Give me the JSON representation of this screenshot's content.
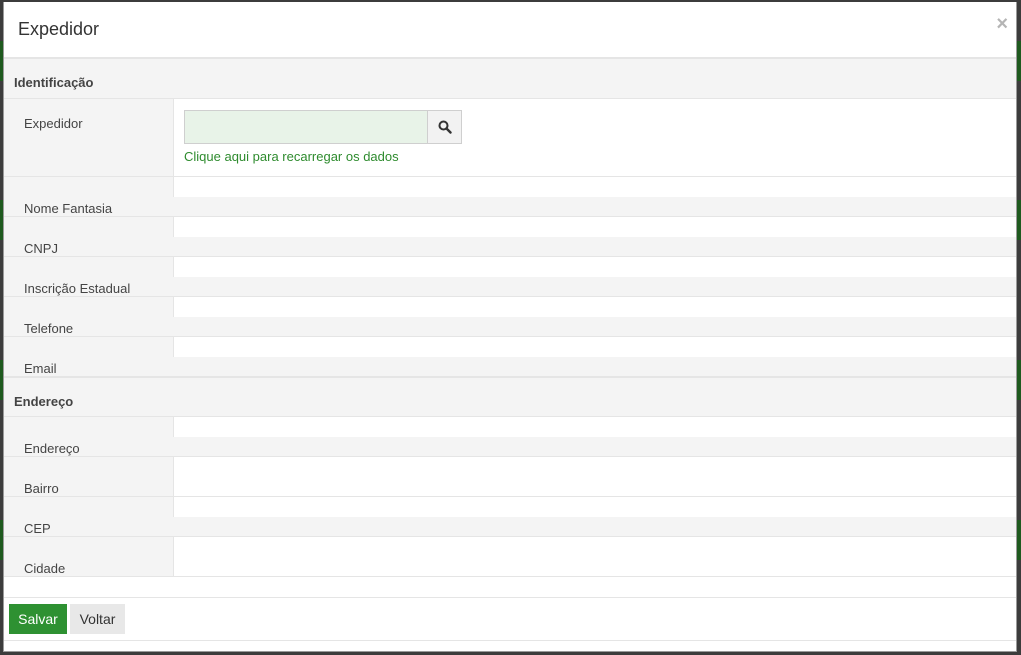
{
  "dialog": {
    "title": "Expedidor",
    "close_glyph": "×"
  },
  "sections": {
    "identificacao": {
      "title": "Identificação",
      "expedidor_label": "Expedidor",
      "expedidor_value": "",
      "search_icon": "search-icon",
      "reload_link": "Clique aqui para recarregar os dados",
      "fields": [
        {
          "label": "Nome Fantasia",
          "value": ""
        },
        {
          "label": "CNPJ",
          "value": ""
        },
        {
          "label": "Inscrição Estadual",
          "value": ""
        },
        {
          "label": "Telefone",
          "value": ""
        },
        {
          "label": "Email",
          "value": ""
        }
      ]
    },
    "endereco": {
      "title": "Endereço",
      "fields": [
        {
          "label": "Endereço",
          "value": ""
        },
        {
          "label": "Bairro",
          "value": ""
        },
        {
          "label": "CEP",
          "value": ""
        },
        {
          "label": "Cidade",
          "value": ""
        }
      ]
    }
  },
  "footer": {
    "save_label": "Salvar",
    "back_label": "Voltar"
  },
  "colors": {
    "primary_green": "#2e9132",
    "link_green": "#2e8b2e",
    "input_bg": "#e8f3e8"
  }
}
